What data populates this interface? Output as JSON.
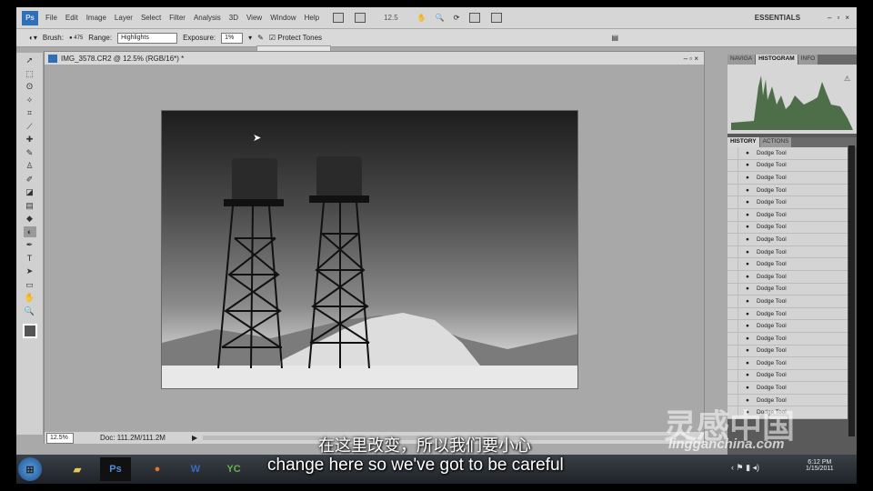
{
  "app": {
    "logo": "Ps",
    "menus": [
      "File",
      "Edit",
      "Image",
      "Layer",
      "Select",
      "Filter",
      "Analysis",
      "3D",
      "View",
      "Window",
      "Help"
    ],
    "zoom": "12.5",
    "workspace": "ESSENTIALS"
  },
  "options": {
    "brush_label": "Brush:",
    "brush_size": "475",
    "range_label": "Range:",
    "range_value": "Highlights",
    "exposure_label": "Exposure:",
    "exposure_value": "1%",
    "protect_tones": "Protect Tones"
  },
  "document": {
    "title": "IMG_3578.CR2 @ 12.5% (RGB/16*) *",
    "zoom": "12.5%",
    "doc_size": "Doc: 111.2M/111.2M"
  },
  "panels": {
    "top_tabs": [
      "NAVIGA",
      "HISTOGRAM",
      "INFO"
    ],
    "bottom_tabs": [
      "HISTORY",
      "ACTIONS"
    ],
    "history": [
      "Dodge Tool",
      "Dodge Tool",
      "Dodge Tool",
      "Dodge Tool",
      "Dodge Tool",
      "Dodge Tool",
      "Dodge Tool",
      "Dodge Tool",
      "Dodge Tool",
      "Dodge Tool",
      "Dodge Tool",
      "Dodge Tool",
      "Dodge Tool",
      "Dodge Tool",
      "Dodge Tool",
      "Dodge Tool",
      "Dodge Tool",
      "Dodge Tool",
      "Dodge Tool",
      "Dodge Tool",
      "Dodge Tool",
      "Dodge Tool"
    ]
  },
  "subtitles": {
    "zh": "在这里改变，所以我们要小心",
    "en": "change here so we've got to be careful"
  },
  "watermark": "lingganchina.com",
  "clock": {
    "time": "6:12 PM",
    "date": "1/15/2011"
  },
  "colors": {
    "histogram": "#4e6e4a"
  }
}
